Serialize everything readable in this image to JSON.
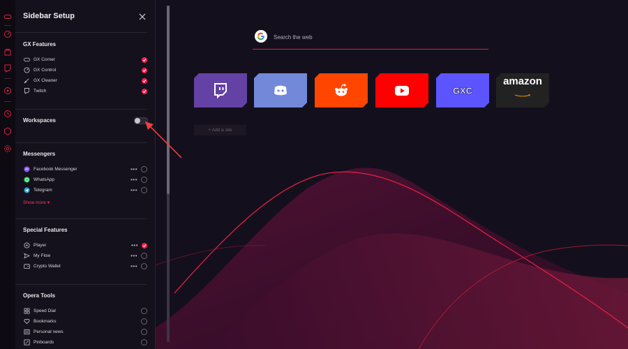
{
  "panel": {
    "title": "Sidebar Setup",
    "close_icon": "close-icon"
  },
  "sections": {
    "gx_features": {
      "title": "GX Features",
      "items": [
        {
          "label": "GX Corner",
          "icon": "gamepad-icon",
          "state": "checked"
        },
        {
          "label": "GX Control",
          "icon": "speedometer-icon",
          "state": "checked"
        },
        {
          "label": "GX Cleaner",
          "icon": "broom-icon",
          "state": "checked"
        },
        {
          "label": "Twitch",
          "icon": "twitch-icon",
          "state": "checked"
        }
      ]
    },
    "workspaces": {
      "title": "Workspaces",
      "toggle_on": false
    },
    "messengers": {
      "title": "Messengers",
      "items": [
        {
          "label": "Facebook Messenger",
          "icon": "messenger-icon",
          "state": "unchecked"
        },
        {
          "label": "WhatsApp",
          "icon": "whatsapp-icon",
          "state": "unchecked"
        },
        {
          "label": "Telegram",
          "icon": "telegram-icon",
          "state": "unchecked"
        }
      ],
      "show_more": "Show more"
    },
    "special_features": {
      "title": "Special Features",
      "items": [
        {
          "label": "Player",
          "icon": "player-icon",
          "state": "checked"
        },
        {
          "label": "My Flow",
          "icon": "flow-icon",
          "state": "unchecked"
        },
        {
          "label": "Crypto Wallet",
          "icon": "wallet-icon",
          "state": "unchecked"
        }
      ]
    },
    "opera_tools": {
      "title": "Opera Tools",
      "items": [
        {
          "label": "Speed Dial",
          "icon": "grid-icon",
          "state": "unchecked"
        },
        {
          "label": "Bookmarks",
          "icon": "heart-icon",
          "state": "unchecked"
        },
        {
          "label": "Personal news",
          "icon": "news-icon",
          "state": "unchecked"
        },
        {
          "label": "Pinboards",
          "icon": "pinboard-icon",
          "state": "unchecked"
        }
      ]
    }
  },
  "search": {
    "placeholder": "Search the web"
  },
  "speed_dial": {
    "tiles": [
      {
        "name": "twitch",
        "color": "#6441a5"
      },
      {
        "name": "discord",
        "color": "#7289da"
      },
      {
        "name": "reddit",
        "color": "#ff4500"
      },
      {
        "name": "youtube",
        "color": "#ff0000"
      },
      {
        "name": "gx",
        "color": "#5c54ff"
      },
      {
        "name": "amazon",
        "color": "#222222",
        "text": "amazon"
      }
    ],
    "add_site": "+ Add a site"
  },
  "colors": {
    "accent": "#fa1e4e",
    "panel": "#15111c",
    "background": "#140f1c"
  }
}
